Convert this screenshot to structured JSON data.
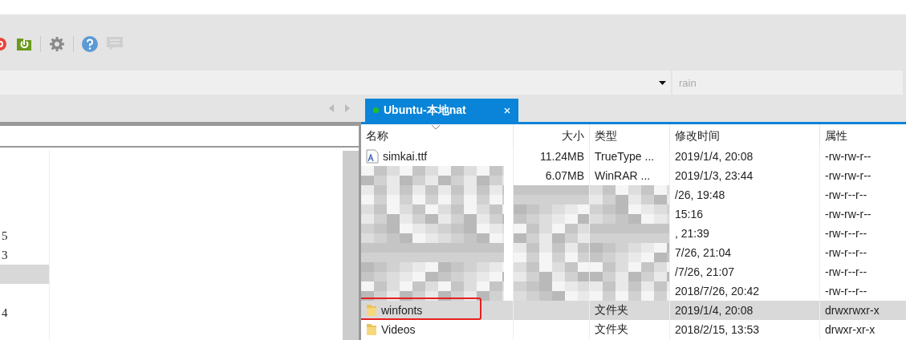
{
  "toolbar": {
    "buttons": [
      {
        "kind": "red"
      },
      {
        "kind": "folder"
      },
      {
        "kind": "sep"
      },
      {
        "kind": "gear"
      },
      {
        "kind": "sep"
      },
      {
        "kind": "help"
      },
      {
        "kind": "chat",
        "disabled": true
      }
    ]
  },
  "address_bar": {
    "search": {
      "placeholder": "rain"
    }
  },
  "tabs": [
    {
      "label": "Ubuntu-本地nat",
      "selected": true,
      "connected": true
    }
  ],
  "left_list": [
    {
      "label": "5",
      "selected": false
    },
    {
      "label": "3",
      "selected": false
    },
    {
      "selected": true
    },
    {
      "selected": false
    },
    {
      "label": "4",
      "selected": false
    }
  ],
  "table": {
    "columns": [
      "名称",
      "大小",
      "类型",
      "修改时间",
      "属性"
    ],
    "rows": [
      {
        "kind": "font",
        "name": "simkai.ttf",
        "size": "11.24MB",
        "type": "TrueType ...",
        "modified": "2019/1/4, 20:08",
        "attributes": "-rw-rw-r--",
        "selected": false
      },
      {
        "obscured": true,
        "size": "6.07MB",
        "type": "WinRAR ...",
        "modified": "2019/1/3, 23:44",
        "attributes": "-rw-rw-r--",
        "selected": false
      },
      {
        "obscured": true,
        "modified": "/26, 19:48",
        "attributes": "-rw-r--r--",
        "selected": false
      },
      {
        "obscured": true,
        "modified": "15:16",
        "attributes": "-rw-rw-r--",
        "selected": false
      },
      {
        "obscured": true,
        "modified": ", 21:39",
        "attributes": "-rw-r--r--",
        "selected": false
      },
      {
        "obscured": true,
        "modified": "7/26, 21:04",
        "attributes": "-rw-r--r--",
        "selected": false
      },
      {
        "obscured": true,
        "modified": "/7/26, 21:07",
        "attributes": "-rw-r--r--",
        "selected": false
      },
      {
        "obscured": true,
        "modified": "2018/7/26, 20:42",
        "attributes": "-rw-r--r--",
        "selected": false
      },
      {
        "kind": "folder",
        "name": "winfonts",
        "type": "文件夹",
        "modified": "2019/1/4, 20:08",
        "attributes": "drwxrwxr-x",
        "selected": true,
        "highlighted": true
      },
      {
        "kind": "folder",
        "name": "Videos",
        "type": "文件夹",
        "modified": "2018/2/15, 13:53",
        "attributes": "drwxr-xr-x",
        "selected": false
      }
    ]
  }
}
